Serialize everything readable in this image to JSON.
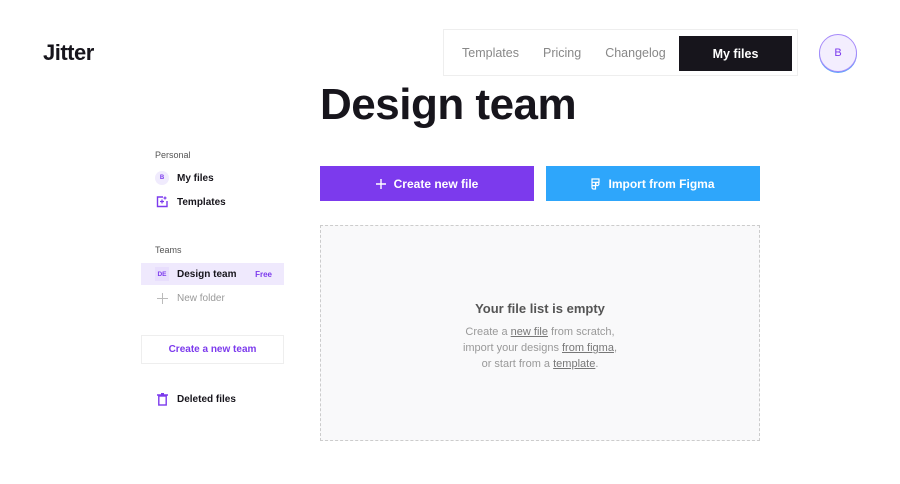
{
  "header": {
    "logo": "Jitter",
    "nav": [
      "Templates",
      "Pricing",
      "Changelog"
    ],
    "my_files": "My files",
    "avatar": "B"
  },
  "title": "Design team",
  "sidebar": {
    "personal_label": "Personal",
    "my_files": {
      "badge": "B",
      "label": "My files"
    },
    "templates": "Templates",
    "teams_label": "Teams",
    "team": {
      "badge": "DE",
      "label": "Design team",
      "plan": "Free"
    },
    "new_folder": "New folder",
    "create_team": "Create a new team",
    "deleted": "Deleted files"
  },
  "actions": {
    "create": "Create new file",
    "import": "Import from Figma"
  },
  "empty": {
    "title": "Your file list is empty",
    "t1": "Create a ",
    "l1": "new file",
    "t2": " from scratch,",
    "t3": "import your designs ",
    "l2": "from figma",
    "t4": ",",
    "t5": "or start from a ",
    "l3": "template",
    "t6": "."
  },
  "colors": {
    "accent": "#7c3aed",
    "figma": "#2ea6fb",
    "dark": "#17151c"
  }
}
